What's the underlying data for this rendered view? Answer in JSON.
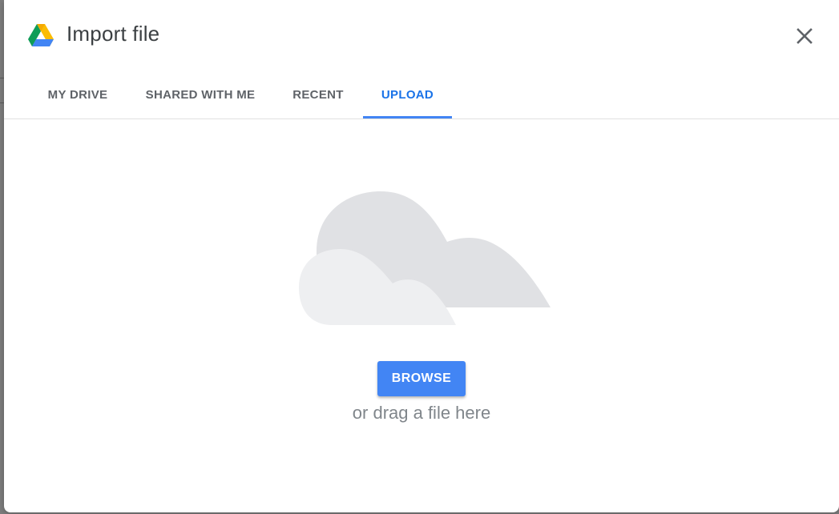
{
  "dialog": {
    "title": "Import file",
    "close_icon": "close-icon",
    "logo_icon": "google-drive-icon"
  },
  "tabs": [
    {
      "label": "MY DRIVE",
      "active": false
    },
    {
      "label": "SHARED WITH ME",
      "active": false
    },
    {
      "label": "RECENT",
      "active": false
    },
    {
      "label": "UPLOAD",
      "active": true
    }
  ],
  "upload": {
    "illustration_icon": "cloud-illustration",
    "browse_label": "BROWSE",
    "drag_hint": "or drag a file here"
  },
  "colors": {
    "accent": "#4285f4",
    "active_tab_text": "#1a73e8",
    "tab_text": "#5f6368",
    "title_text": "#3c4043",
    "hint_text": "#80868b"
  }
}
